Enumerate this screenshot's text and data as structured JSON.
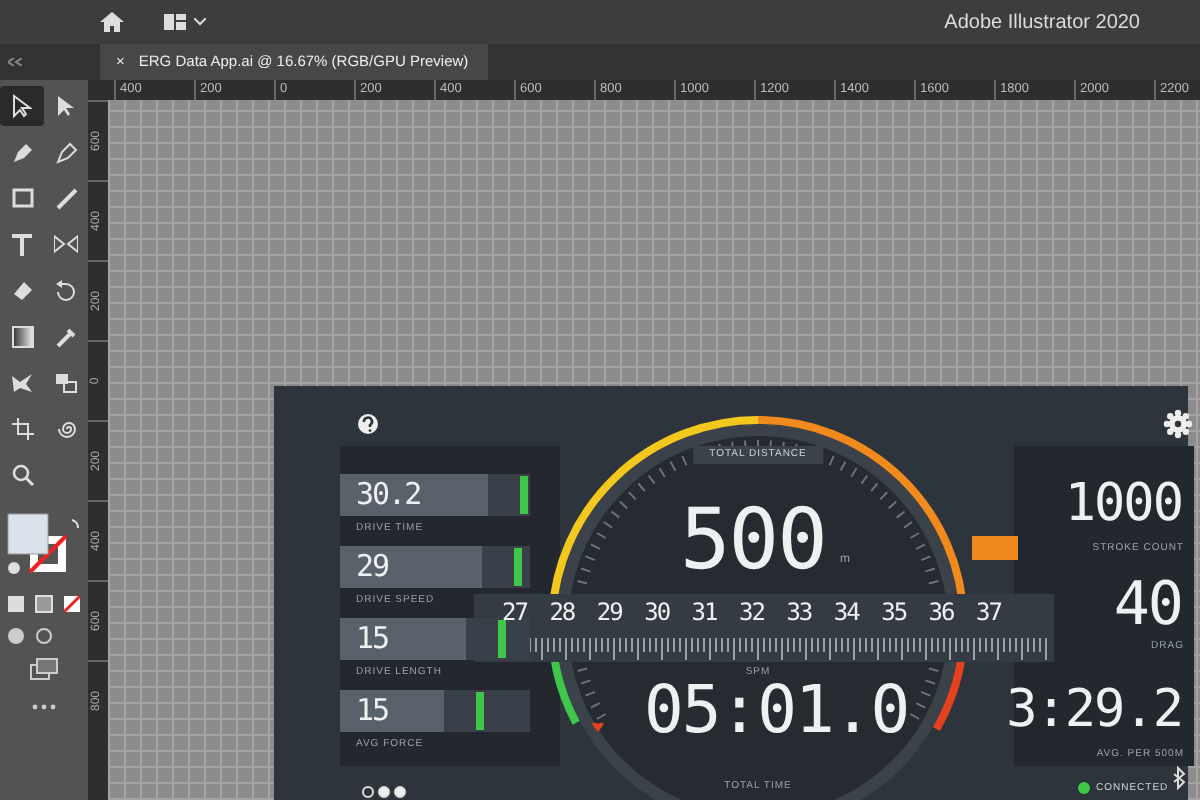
{
  "app_bar": {
    "title": "Adobe Illustrator 2020"
  },
  "document_tab": {
    "close": "×",
    "title": "ERG Data App.ai @ 16.67% (RGB/GPU Preview)"
  },
  "horizontal_ruler": {
    "labels": [
      "400",
      "200",
      "0",
      "200",
      "400",
      "600",
      "800",
      "1000",
      "1200",
      "1400",
      "1600",
      "1800",
      "2000",
      "2200"
    ]
  },
  "vertical_ruler": {
    "labels": [
      "600",
      "400",
      "200",
      "0",
      "200",
      "400",
      "600",
      "800"
    ]
  },
  "dashboard": {
    "left_metrics": [
      {
        "value": "30.2",
        "label": "DRIVE TIME",
        "level": 0.78
      },
      {
        "value": "29",
        "label": "DRIVE SPEED",
        "level": 0.75
      },
      {
        "value": "15",
        "label": "DRIVE LENGTH",
        "level": 0.66
      },
      {
        "value": "15",
        "label": "AVG FORCE",
        "level": 0.55
      }
    ],
    "gauge": {
      "top_label": "TOTAL DISTANCE",
      "distance": "500",
      "unit": "m",
      "scale": [
        "27",
        "28",
        "29",
        "30",
        "31",
        "32",
        "33",
        "34",
        "35",
        "36",
        "37"
      ],
      "scale_label": "SPM",
      "time": "05:01.0",
      "bottom_label": "TOTAL TIME"
    },
    "right_metrics": [
      {
        "value": "1000",
        "label": "STROKE COUNT"
      },
      {
        "value": "40",
        "label": "DRAG"
      },
      {
        "value": "3:29.2",
        "label": "AVG. PER 500M"
      }
    ],
    "pager": [
      {
        "selected": true
      },
      {
        "selected": false
      },
      {
        "selected": false
      }
    ],
    "status": {
      "text": "CONNECTED",
      "connected": true
    }
  }
}
